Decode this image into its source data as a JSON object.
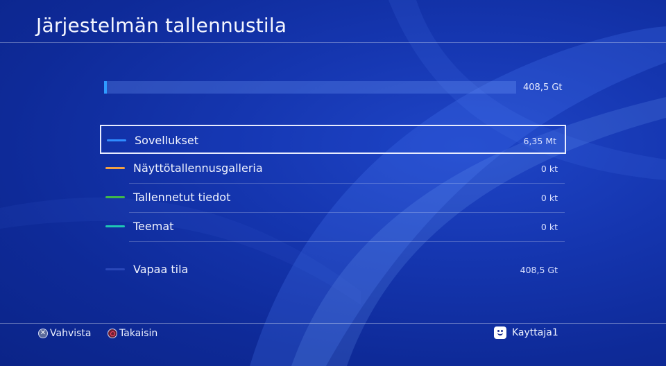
{
  "header": {
    "title": "Järjestelmän tallennustila"
  },
  "usage": {
    "total_label": "408,5 Gt",
    "used_fraction": 0.006,
    "fill_color": "#2f9bff"
  },
  "categories": [
    {
      "label": "Sovellukset",
      "size": "6,35 Mt",
      "color": "#2f8cff",
      "selected": true
    },
    {
      "label": "Näyttötallennusgalleria",
      "size": "0 kt",
      "color": "#f2a043",
      "selected": false
    },
    {
      "label": "Tallennetut tiedot",
      "size": "0 kt",
      "color": "#3fb84a",
      "selected": false
    },
    {
      "label": "Teemat",
      "size": "0 kt",
      "color": "#1fc7b4",
      "selected": false
    },
    {
      "label": "Vapaa tila",
      "size": "408,5 Gt",
      "color": "#2a47b8",
      "selected": false
    }
  ],
  "footer": {
    "confirm_label": "Vahvista",
    "back_label": "Takaisin",
    "user_name": "Kayttaja1"
  }
}
